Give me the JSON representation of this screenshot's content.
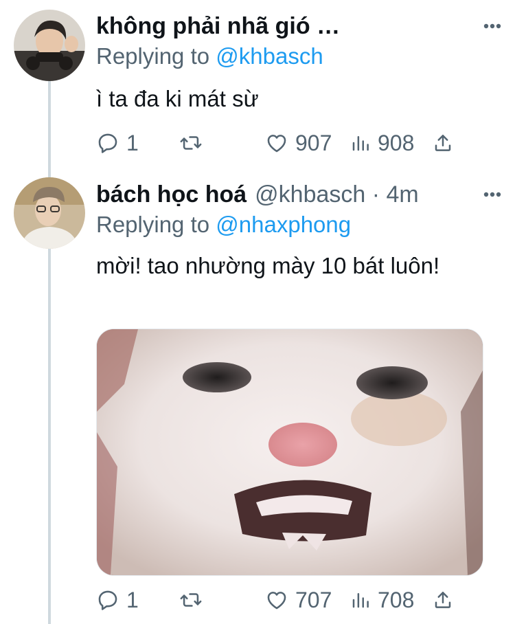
{
  "tweets": [
    {
      "display_name": "không phải nhã gió …",
      "handle_meta": "",
      "replying_label": "Replying to",
      "replying_to": "@khbasch",
      "text": "ì ta đa ki mát sừ",
      "stats": {
        "replies": "1",
        "retweets": "",
        "likes": "907",
        "views": "908"
      }
    },
    {
      "display_name": "bách học hoá",
      "handle_meta": "@khbasch · 4m",
      "replying_label": "Replying to",
      "replying_to": "@nhaxphong",
      "text": "mời! tao nhường mày 10 bát luôn!",
      "media": {
        "description_icon": "cat-photo"
      },
      "stats": {
        "replies": "1",
        "retweets": "",
        "likes": "707",
        "views": "708"
      }
    }
  ],
  "colors": {
    "text": "#0f1419",
    "secondary": "#536471",
    "link": "#1d9bf0",
    "thread_line": "#cfd9de"
  },
  "icons": {
    "more": "more-dots-icon",
    "reply": "reply-bubble-icon",
    "retweet": "retweet-icon",
    "like": "heart-icon",
    "views": "views-bars-icon",
    "share": "share-upload-icon"
  }
}
